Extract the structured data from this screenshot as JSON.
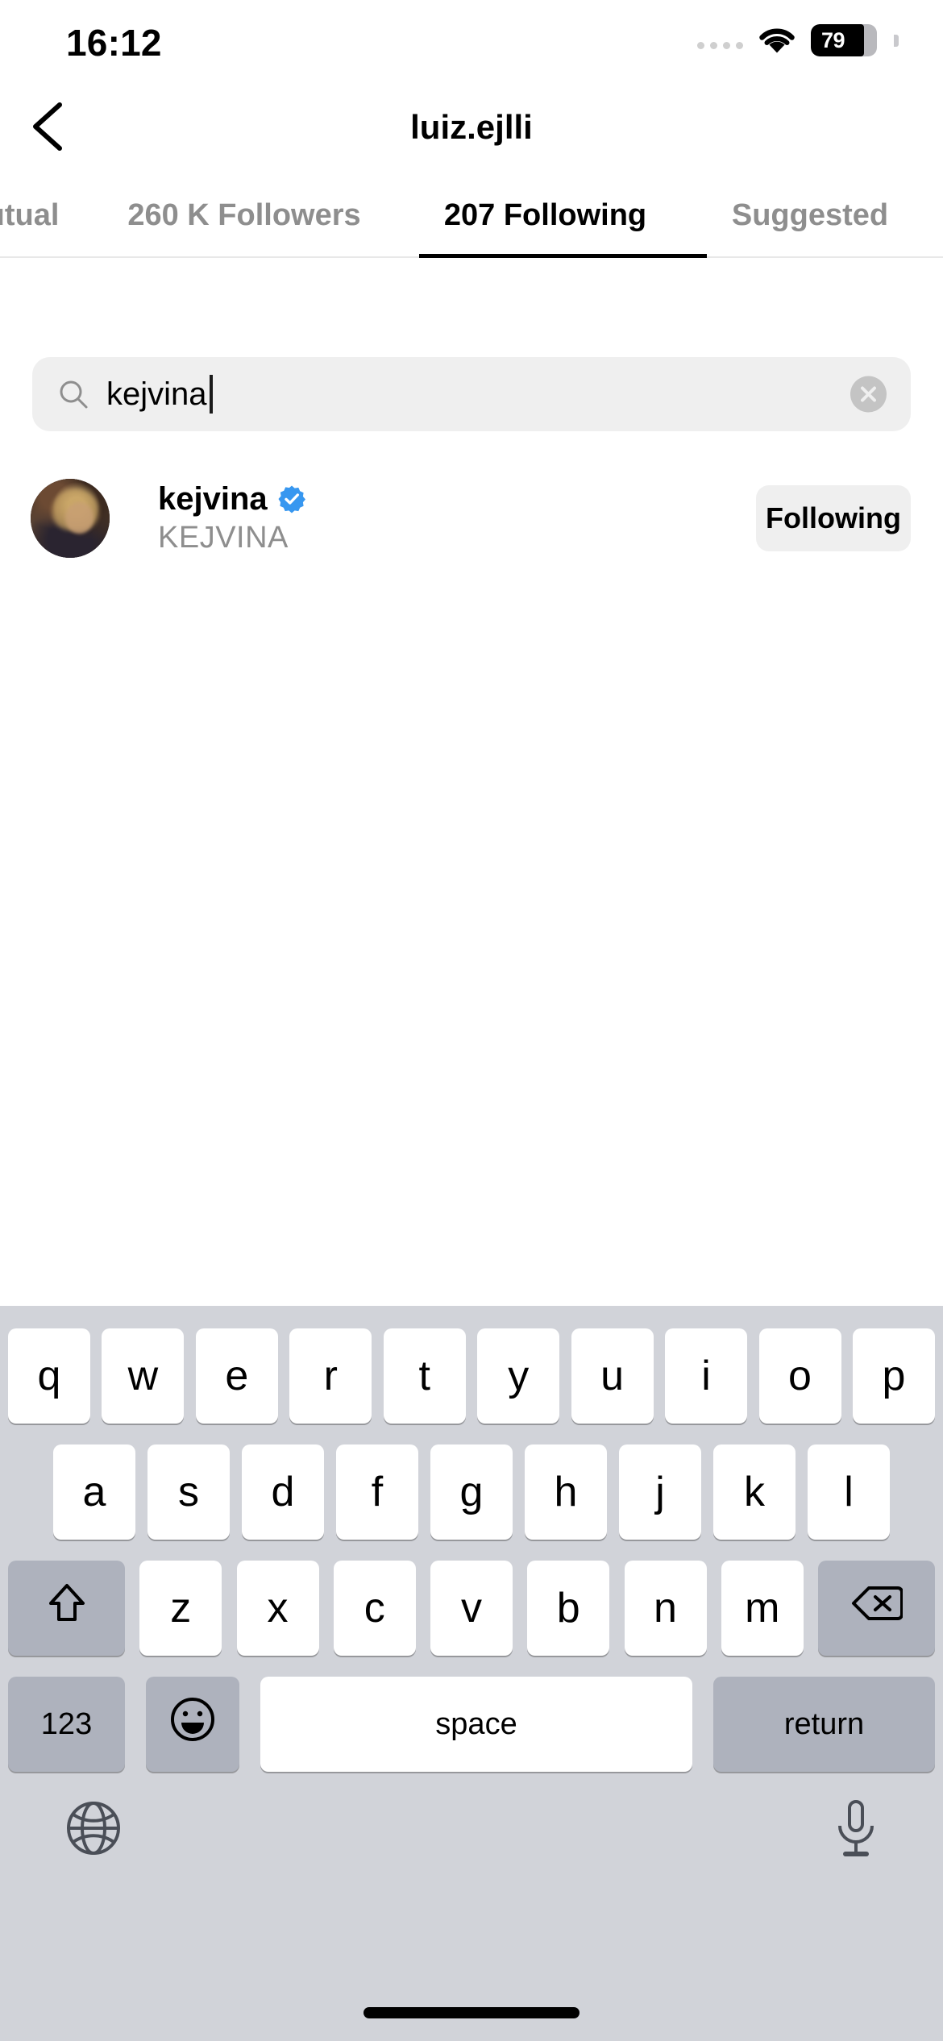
{
  "status_bar": {
    "time": "16:12",
    "battery_percent": "79",
    "wifi_icon": "wifi-icon",
    "dots_icon": "signal-dots-icon",
    "battery_icon": "battery-icon"
  },
  "nav": {
    "back_icon": "chevron-left-icon",
    "title": "luiz.ejlli"
  },
  "tabs": {
    "items": [
      {
        "label": "utual",
        "active": false
      },
      {
        "label": "260 K Followers",
        "active": false
      },
      {
        "label": "207 Following",
        "active": true
      },
      {
        "label": "Suggested",
        "active": false
      }
    ]
  },
  "search": {
    "icon": "search-icon",
    "value": "kejvina",
    "placeholder": "Search",
    "clear_icon": "clear-circle-icon"
  },
  "results": [
    {
      "avatar": "user-avatar",
      "username": "kejvina",
      "verified": true,
      "verified_icon": "verified-badge-icon",
      "verified_color": "#3797f0",
      "full_name": "KEJVINA",
      "action_label": "Following"
    }
  ],
  "keyboard": {
    "row1": [
      "q",
      "w",
      "e",
      "r",
      "t",
      "y",
      "u",
      "i",
      "o",
      "p"
    ],
    "row2": [
      "a",
      "s",
      "d",
      "f",
      "g",
      "h",
      "j",
      "k",
      "l"
    ],
    "row3_shift_icon": "shift-up-arrow-icon",
    "row3": [
      "z",
      "x",
      "c",
      "v",
      "b",
      "n",
      "m"
    ],
    "row3_backspace_icon": "backspace-delete-icon",
    "numbers_label": "123",
    "emoji_icon": "emoji-smiley-icon",
    "space_label": "space",
    "return_label": "return",
    "globe_icon": "globe-language-icon",
    "mic_icon": "microphone-dictation-icon"
  },
  "colors": {
    "accent": "#3797f0",
    "keyboard_bg": "#d1d3d9",
    "key_gray": "#aeb2bd",
    "field_bg": "#efefef",
    "muted_text": "#8e8e8e"
  }
}
